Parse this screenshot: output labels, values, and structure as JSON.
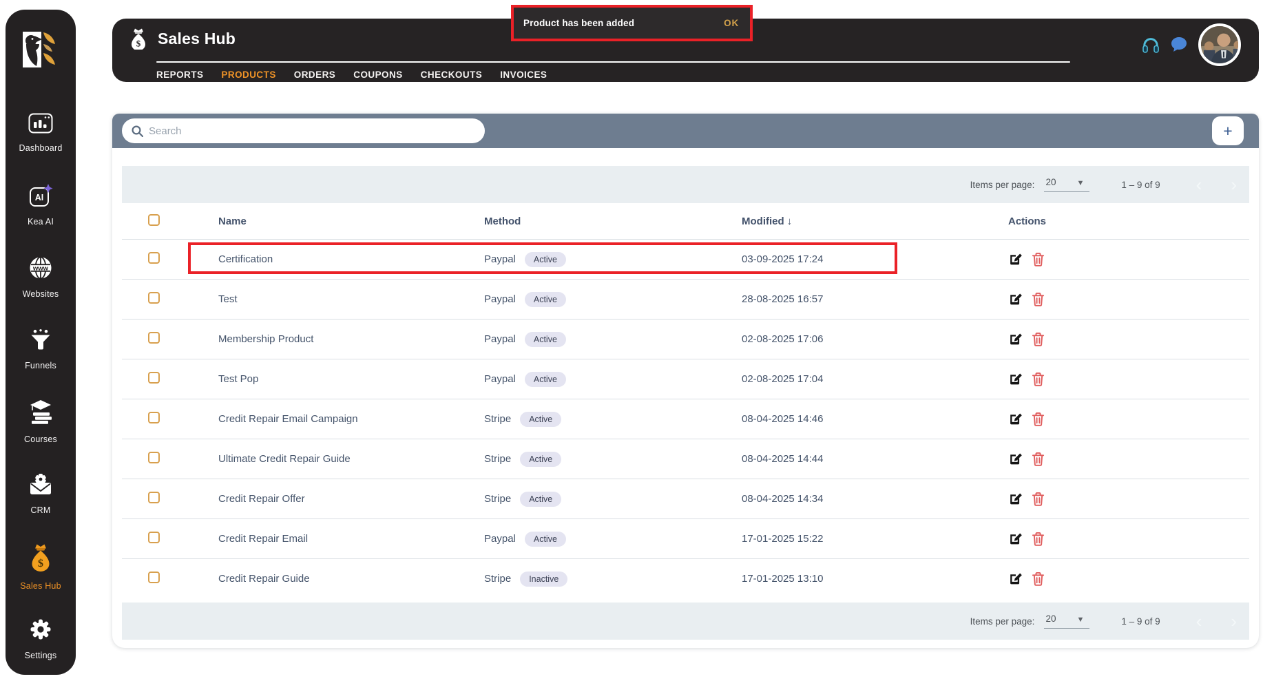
{
  "colors": {
    "dark_shell": "#242122",
    "accent_orange": "#ef9327",
    "search_band": "#6e7d90",
    "pager_band": "#e9eef1",
    "table_text": "#44536a",
    "badge_bg": "#e4e4f1",
    "delete_red": "#e05c5c",
    "annotation_red": "#ea2127",
    "toast_bg": "#2d2a2b",
    "toast_ok": "#d2a14b"
  },
  "icons": {
    "sort_desc": "↓",
    "caret_down": "▼",
    "chevron_left": "‹",
    "chevron_right": "›",
    "plus": "+"
  },
  "sidebar": {
    "items": [
      {
        "label": "Dashboard",
        "icon": "dashboard-icon",
        "active": false
      },
      {
        "label": "Kea AI",
        "icon": "kea-ai-icon",
        "active": false
      },
      {
        "label": "Websites",
        "icon": "globe-www-icon",
        "active": false
      },
      {
        "label": "Funnels",
        "icon": "funnel-icon",
        "active": false
      },
      {
        "label": "Courses",
        "icon": "graduation-books-icon",
        "active": false
      },
      {
        "label": "CRM",
        "icon": "envelope-gear-icon",
        "active": false
      },
      {
        "label": "Sales Hub",
        "icon": "money-bag-icon",
        "active": true
      },
      {
        "label": "Settings",
        "icon": "gear-icon",
        "active": false
      }
    ]
  },
  "header": {
    "title": "Sales Hub",
    "tabs": [
      {
        "label": "REPORTS",
        "active": false
      },
      {
        "label": "PRODUCTS",
        "active": true
      },
      {
        "label": "ORDERS",
        "active": false
      },
      {
        "label": "COUPONS",
        "active": false
      },
      {
        "label": "CHECKOUTS",
        "active": false
      },
      {
        "label": "INVOICES",
        "active": false
      }
    ]
  },
  "toast": {
    "message": "Product has been added",
    "action_label": "OK"
  },
  "search": {
    "placeholder": "Search"
  },
  "pagination": {
    "items_per_page_label": "Items per page:",
    "page_size": "20",
    "range_label": "1 – 9 of 9"
  },
  "table": {
    "columns": {
      "name": "Name",
      "method": "Method",
      "modified": "Modified",
      "actions": "Actions"
    },
    "rows": [
      {
        "name": "Certification",
        "method": "Paypal",
        "status": "Active",
        "modified": "03-09-2025 17:24",
        "highlighted": true
      },
      {
        "name": "Test",
        "method": "Paypal",
        "status": "Active",
        "modified": "28-08-2025 16:57",
        "highlighted": false
      },
      {
        "name": "Membership Product",
        "method": "Paypal",
        "status": "Active",
        "modified": "02-08-2025 17:06",
        "highlighted": false
      },
      {
        "name": "Test Pop",
        "method": "Paypal",
        "status": "Active",
        "modified": "02-08-2025 17:04",
        "highlighted": false
      },
      {
        "name": "Credit Repair Email Campaign",
        "method": "Stripe",
        "status": "Active",
        "modified": "08-04-2025 14:46",
        "highlighted": false
      },
      {
        "name": "Ultimate Credit Repair Guide",
        "method": "Stripe",
        "status": "Active",
        "modified": "08-04-2025 14:44",
        "highlighted": false
      },
      {
        "name": "Credit Repair Offer",
        "method": "Stripe",
        "status": "Active",
        "modified": "08-04-2025 14:34",
        "highlighted": false
      },
      {
        "name": "Credit Repair Email",
        "method": "Paypal",
        "status": "Active",
        "modified": "17-01-2025 15:22",
        "highlighted": false
      },
      {
        "name": "Credit Repair Guide",
        "method": "Stripe",
        "status": "Inactive",
        "modified": "17-01-2025 13:10",
        "highlighted": false
      }
    ]
  }
}
